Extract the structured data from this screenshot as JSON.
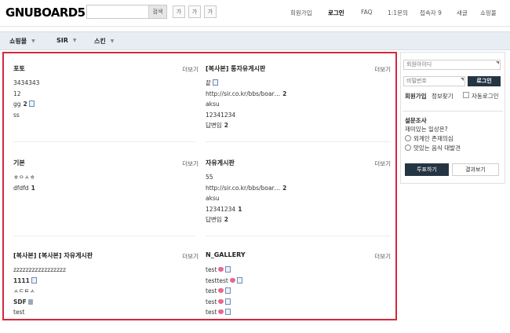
{
  "header": {
    "logo": "GNUBOARD5",
    "search": {
      "placeholder": "",
      "button": "검색"
    },
    "font_buttons": [
      "가",
      "가",
      "가"
    ],
    "gnb": [
      "회원가입",
      "로그인",
      "FAQ",
      "1:1문의",
      "접속자 9",
      "새글",
      "쇼핑몰"
    ]
  },
  "nav": {
    "items": [
      "쇼핑몰",
      "SIR",
      "스킨"
    ]
  },
  "latest": {
    "more_label": "더보기",
    "boxes": [
      {
        "title": "포토",
        "items": [
          {
            "text": "3434343",
            "count": "",
            "icon": ""
          },
          {
            "text": "12",
            "count": "",
            "icon": ""
          },
          {
            "text": "gg",
            "count": "2",
            "icon": "document-icon"
          },
          {
            "text": "ss",
            "count": "",
            "icon": ""
          }
        ]
      },
      {
        "title": "[복사본] 통자유게시판",
        "items": [
          {
            "text": "끝",
            "count": "",
            "icon": "document-icon"
          },
          {
            "text": "http://sir.co.kr/bbs/boar…",
            "count": "2",
            "icon": ""
          },
          {
            "text": "aksu",
            "count": "",
            "icon": ""
          },
          {
            "text": "12341234",
            "count": "",
            "icon": ""
          },
          {
            "text": "답변임",
            "count": "2",
            "icon": ""
          }
        ]
      },
      {
        "title": "기본",
        "items": [
          {
            "text": "ㅎㅇㅅㅎ",
            "count": "",
            "icon": ""
          },
          {
            "text": "dfdfd",
            "count": "1",
            "icon": ""
          }
        ]
      },
      {
        "title": "자유게시판",
        "items": [
          {
            "text": "55",
            "count": "",
            "icon": ""
          },
          {
            "text": "http://sir.co.kr/bbs/boar…",
            "count": "2",
            "icon": ""
          },
          {
            "text": "aksu",
            "count": "",
            "icon": ""
          },
          {
            "text": "12341234",
            "count": "1",
            "icon": ""
          },
          {
            "text": "답변임",
            "count": "2",
            "icon": ""
          }
        ]
      },
      {
        "title": "[복사본] [복사본] 자유게시판",
        "items": [
          {
            "text": "zzzzzzzzzzzzzzzzz",
            "count": "",
            "icon": ""
          },
          {
            "text": "1111",
            "count": "",
            "icon": "document-icon"
          },
          {
            "text": "ㅅㄷㅌㅅ",
            "count": "",
            "icon": ""
          },
          {
            "text": "SDF",
            "count": "",
            "icon": "lock-icon"
          },
          {
            "text": "test",
            "count": "",
            "icon": ""
          }
        ]
      },
      {
        "title": "N_GALLERY",
        "items": [
          {
            "text": "test",
            "count": "",
            "icon": "heart-document-icon"
          },
          {
            "text": "testtest",
            "count": "",
            "icon": "heart-document-icon"
          },
          {
            "text": "test",
            "count": "",
            "icon": "heart-document-icon"
          },
          {
            "text": "test",
            "count": "",
            "icon": "heart-document-icon"
          },
          {
            "text": "test",
            "count": "",
            "icon": "heart-document-icon"
          }
        ]
      }
    ]
  },
  "aside": {
    "login": {
      "id_placeholder": "회원아이디",
      "pw_placeholder": "비밀번호",
      "login_button": "로그인",
      "join_link": "회원가입",
      "find_link": "정보찾기",
      "auto_login": "자동로그인"
    },
    "poll": {
      "title": "설문조사",
      "question": "재미있는 일상은?",
      "options": [
        "외계인 존재의심",
        "맛있는 음식 대발견"
      ],
      "vote_button": "투표하기",
      "result_button": "결과보기"
    }
  },
  "colors": {
    "highlight_border": "#d6283b",
    "nav_bg": "#e8edf3",
    "dark_button": "#253443"
  }
}
